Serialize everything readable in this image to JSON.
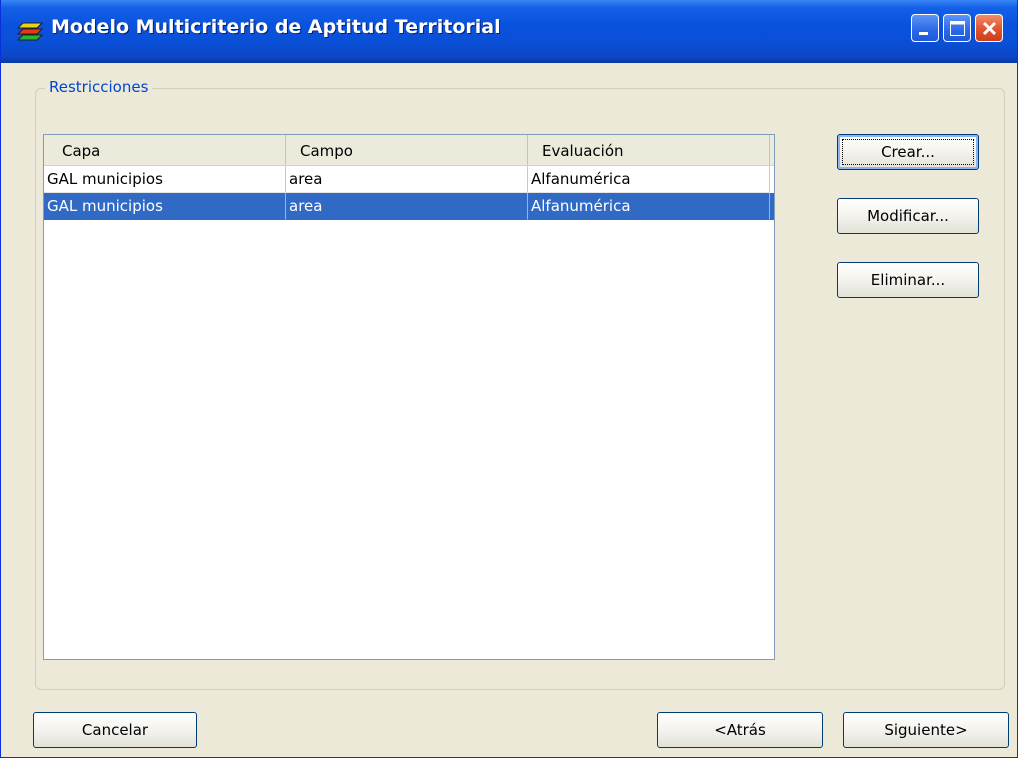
{
  "window": {
    "title": "Modelo Multicriterio de Aptitud Territorial",
    "minimize_icon": "minimize-icon",
    "maximize_icon": "maximize-icon",
    "close_icon": "close-icon",
    "app_icon": "layers-icon"
  },
  "restrictions": {
    "group_label": "Restricciones",
    "columns": [
      "Capa",
      "Campo",
      "Evaluación"
    ],
    "rows": [
      {
        "capa": "GAL municipios",
        "campo": "area",
        "evaluacion": "Alfanumérica",
        "selected": false
      },
      {
        "capa": "GAL municipios",
        "campo": "area",
        "evaluacion": "Alfanumérica",
        "selected": true
      }
    ]
  },
  "actions": {
    "create_label": "Crear...",
    "modify_label": "Modificar...",
    "delete_label": "Eliminar..."
  },
  "footer": {
    "cancel_label": "Cancelar",
    "back_label": "<Atrás",
    "next_label": "Siguiente>"
  },
  "colors": {
    "titlebar": "#0a52dd",
    "selection": "#316ac5",
    "group_label": "#0046d5",
    "close_button": "#e0532c"
  }
}
